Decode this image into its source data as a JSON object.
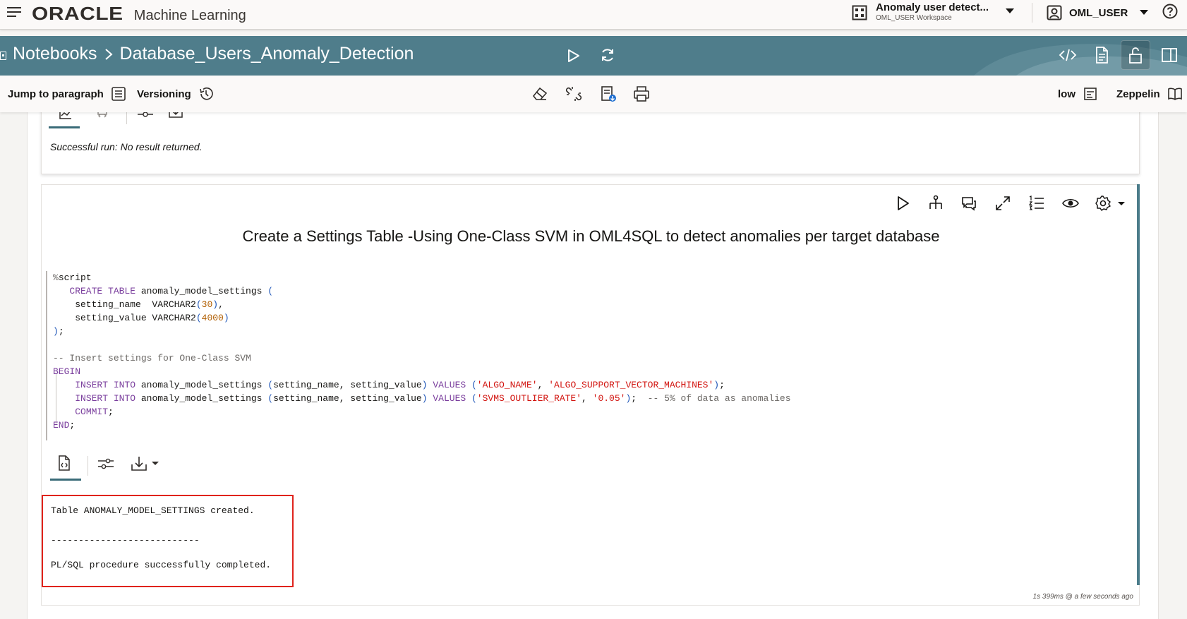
{
  "app": {
    "brand_oracle": "ORACLE",
    "brand_product": "Machine Learning"
  },
  "workspace": {
    "title": "Anomaly user detect...",
    "subtitle": "OML_USER Workspace"
  },
  "user": {
    "name": "OML_USER"
  },
  "breadcrumb": {
    "root": "Notebooks",
    "current": "Database_Users_Anomaly_Detection"
  },
  "toolbar": {
    "jump_label": "Jump to paragraph",
    "versioning_label": "Versioning",
    "service_level": "low",
    "interpreter": "Zeppelin"
  },
  "prev_paragraph": {
    "result_text": "Successful run: No result returned."
  },
  "paragraph": {
    "title": "Create a Settings Table -Using One-Class SVM in OML4SQL to detect anomalies per target database",
    "output_lines": [
      "Table ANOMALY_MODEL_SETTINGS created.",
      "---------------------------",
      "PL/SQL procedure successfully completed."
    ],
    "timestamp": "1s 399ms @ a few seconds ago"
  },
  "icons": {
    "menu": "hamburger-icon",
    "workspace": "grid-icon",
    "user": "user-icon",
    "help": "help-icon",
    "run": "play-icon",
    "refresh": "refresh-icon",
    "code": "code-icon",
    "document": "document-icon",
    "lock": "unlock-icon",
    "panel": "split-panel-icon",
    "eraser": "eraser-icon",
    "unlink": "unlink-icon",
    "export": "export-icon",
    "print": "print-icon"
  },
  "colors": {
    "header_band": "#4f7d8b",
    "highlight_box": "#e0231c",
    "accent_bar": "#4b7c8a"
  }
}
